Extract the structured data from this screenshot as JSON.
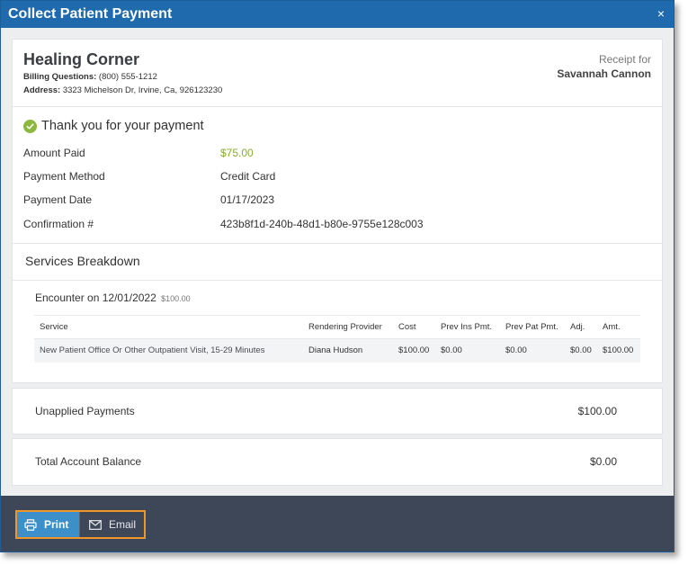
{
  "dialog": {
    "title": "Collect Patient Payment",
    "close_glyph": "×"
  },
  "practice": {
    "name": "Healing Corner",
    "billing_label": "Billing Questions:",
    "billing_phone": "(800) 555-1212",
    "address_label": "Address:",
    "address_value": "3323 Michelson Dr, Irvine, Ca, 926123230"
  },
  "receipt": {
    "label": "Receipt for",
    "patient_name": "Savannah Cannon"
  },
  "payment": {
    "thanks": "Thank you for your payment",
    "rows": [
      {
        "label": "Amount Paid",
        "value": "$75.00"
      },
      {
        "label": "Payment Method",
        "value": "Credit Card"
      },
      {
        "label": "Payment Date",
        "value": "01/17/2023"
      },
      {
        "label": "Confirmation #",
        "value": "423b8f1d-240b-48d1-b80e-9755e128c003"
      }
    ]
  },
  "services": {
    "title": "Services Breakdown",
    "encounter_label": "Encounter on 12/01/2022",
    "encounter_amount": "$100.00",
    "columns": [
      "Service",
      "Rendering Provider",
      "Cost",
      "Prev Ins Pmt.",
      "Prev Pat Pmt.",
      "Adj.",
      "Amt."
    ],
    "rows": [
      [
        "New Patient Office Or Other Outpatient Visit, 15-29 Minutes",
        "Diana Hudson",
        "$100.00",
        "$0.00",
        "$0.00",
        "$0.00",
        "$100.00"
      ]
    ]
  },
  "unapplied": {
    "label": "Unapplied Payments",
    "value": "$100.00"
  },
  "total": {
    "label": "Total Account Balance",
    "value": "$0.00"
  },
  "footer": {
    "print_label": "Print",
    "email_label": "Email"
  },
  "colors": {
    "titlebar": "#1f6aad",
    "accent_green": "#86ad2e",
    "footer_bg": "#3e4757",
    "print_button": "#3c8fc8",
    "highlight_border": "#f0962a"
  }
}
